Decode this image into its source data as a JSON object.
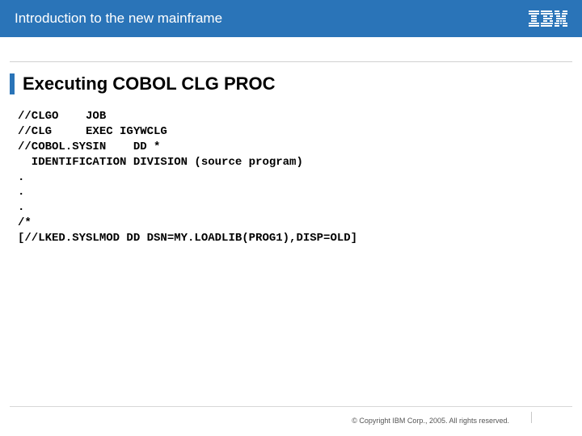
{
  "header": {
    "title": "Introduction to the new mainframe",
    "logo_alt": "IBM"
  },
  "slide": {
    "title": "Executing COBOL CLG PROC"
  },
  "code": {
    "line1": "//CLGO    JOB",
    "line2": "//CLG     EXEC IGYWCLG",
    "line3": "//COBOL.SYSIN    DD *",
    "line4": "  IDENTIFICATION DIVISION (source program)",
    "line5": ".",
    "line6": ".",
    "line7": ".",
    "line8": "/*",
    "line9": "[//LKED.SYSLMOD DD DSN=MY.LOADLIB(PROG1),DISP=OLD]"
  },
  "footer": {
    "copyright": "© Copyright IBM Corp., 2005. All rights reserved."
  }
}
